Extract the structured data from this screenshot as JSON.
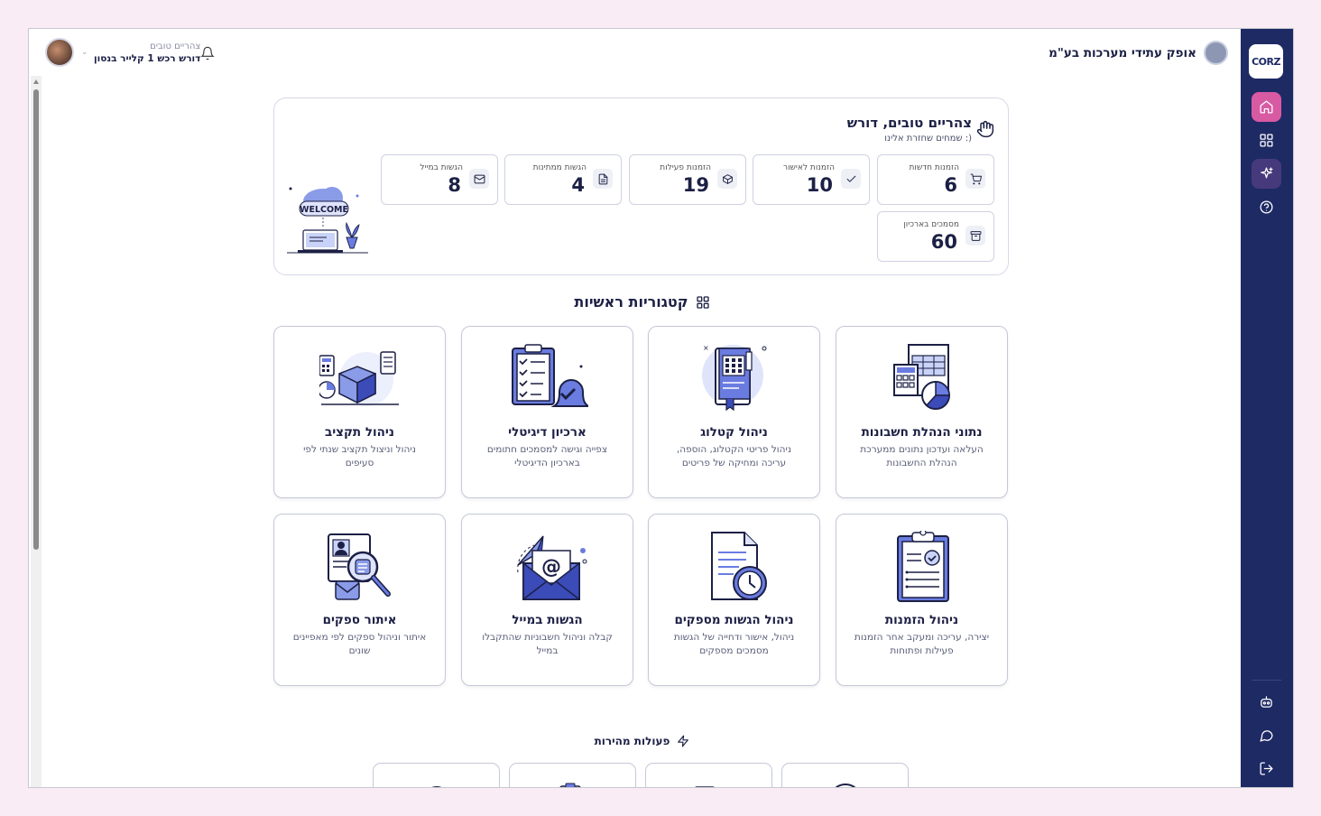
{
  "topbar": {
    "company": "אופק עתידי מערכות בע\"מ",
    "greeting": "צהריים טובים",
    "user_name": "דורש רכש 1 קלייר בנסון"
  },
  "sidebar": {
    "logo": "CORZ",
    "items": [
      "home-icon",
      "grid-icon",
      "sparkles-icon",
      "help-icon"
    ],
    "bottom_items": [
      "bot-icon",
      "chat-icon",
      "logout-icon"
    ]
  },
  "welcome": {
    "title": "צהריים טובים, דורש",
    "subtitle": "שמחים שחזרת אלינו :)",
    "illustration_text": "WELCOME",
    "stats": [
      {
        "label": "הזמנות חדשות",
        "value": "6",
        "icon": "cart-icon"
      },
      {
        "label": "הזמנות לאישור",
        "value": "10",
        "icon": "check-icon"
      },
      {
        "label": "הזמנות פעילות",
        "value": "19",
        "icon": "box-icon"
      },
      {
        "label": "הגשות ממתינות",
        "value": "4",
        "icon": "document-icon"
      },
      {
        "label": "הגשות במייל",
        "value": "8",
        "icon": "mail-icon"
      },
      {
        "label": "מסמכים בארכיון",
        "value": "60",
        "icon": "archive-icon"
      }
    ]
  },
  "categories": {
    "title": "קטגוריות ראשיות",
    "items": [
      {
        "title": "נתוני הנהלת חשבונות",
        "desc": "העלאה ועדכון נתונים ממערכת הנהלת החשבונות",
        "icon": "spreadsheet-icon"
      },
      {
        "title": "ניהול קטלוג",
        "desc": "ניהול פריטי הקטלוג, הוספה, עריכה ומחיקה של פריטים",
        "icon": "catalog-book-icon"
      },
      {
        "title": "ארכיון דיגיטלי",
        "desc": "צפייה וגישה למסמכים חתומים בארכיון הדיגיטלי",
        "icon": "checklist-bell-icon"
      },
      {
        "title": "ניהול תקציב",
        "desc": "ניהול וניצול תקציב שנתי לפי סעיפים",
        "icon": "budget-cube-icon"
      },
      {
        "title": "ניהול הזמנות",
        "desc": "יצירה, עריכה ומעקב אחר הזמנות פעילות ופתוחות",
        "icon": "clipboard-icon"
      },
      {
        "title": "ניהול הגשות מספקים",
        "desc": "ניהול, אישור ודחייה של הגשות מסמכים מספקים",
        "icon": "document-clock-icon"
      },
      {
        "title": "הגשות במייל",
        "desc": "קבלה וניהול חשבוניות שהתקבלו במייל",
        "icon": "email-envelope-icon"
      },
      {
        "title": "איתור ספקים",
        "desc": "איתור וניהול ספקים לפי מאפיינים שונים",
        "icon": "supplier-search-icon"
      }
    ]
  },
  "quick_actions": {
    "title": "פעולות מהירות",
    "items": [
      {
        "icon": "plus-circle-icon"
      },
      {
        "icon": "mail-user-icon"
      },
      {
        "icon": "clipboard-search-icon"
      },
      {
        "icon": "support-headset-icon"
      }
    ]
  }
}
